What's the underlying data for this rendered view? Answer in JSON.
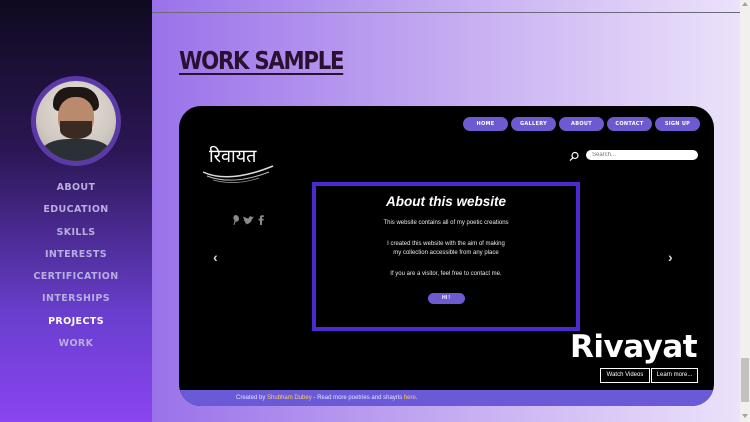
{
  "sidebar": {
    "items": [
      "ABOUT",
      "EDUCATION",
      "SKILLS",
      "INTERESTS",
      "CERTIFICATION",
      "INTERSHIPS",
      "PROJECTS",
      "WORK"
    ],
    "active": "PROJECTS"
  },
  "main": {
    "section_title": "WORK SAMPLE"
  },
  "preview": {
    "nav": [
      "HOME",
      "GALLERY",
      "ABOUT",
      "CONTACT",
      "SIGN UP"
    ],
    "logo_text": "रिवायत",
    "search_placeholder": "Search...",
    "about_title": "About this website",
    "about_p1": "This website contains all of my poetic creations",
    "about_p2": "I created this website with the aim of making my collection accessible from any place",
    "about_p3": "If you are a visitor, feel free to contact me.",
    "hi_button": "HI !",
    "brand": "Rivayat",
    "watch_videos": "Watch Videos",
    "learn_more": "Learn more...",
    "footer_prefix": "Created by ",
    "footer_author": "Shubham Dubey",
    "footer_middle": " - Read more poetries and shayris ",
    "footer_link": "here",
    "footer_suffix": ".",
    "prev_arrow": "‹",
    "next_arrow": "›"
  },
  "colors": {
    "accent": "#6c5ad0",
    "frame": "#4d2ad0"
  }
}
